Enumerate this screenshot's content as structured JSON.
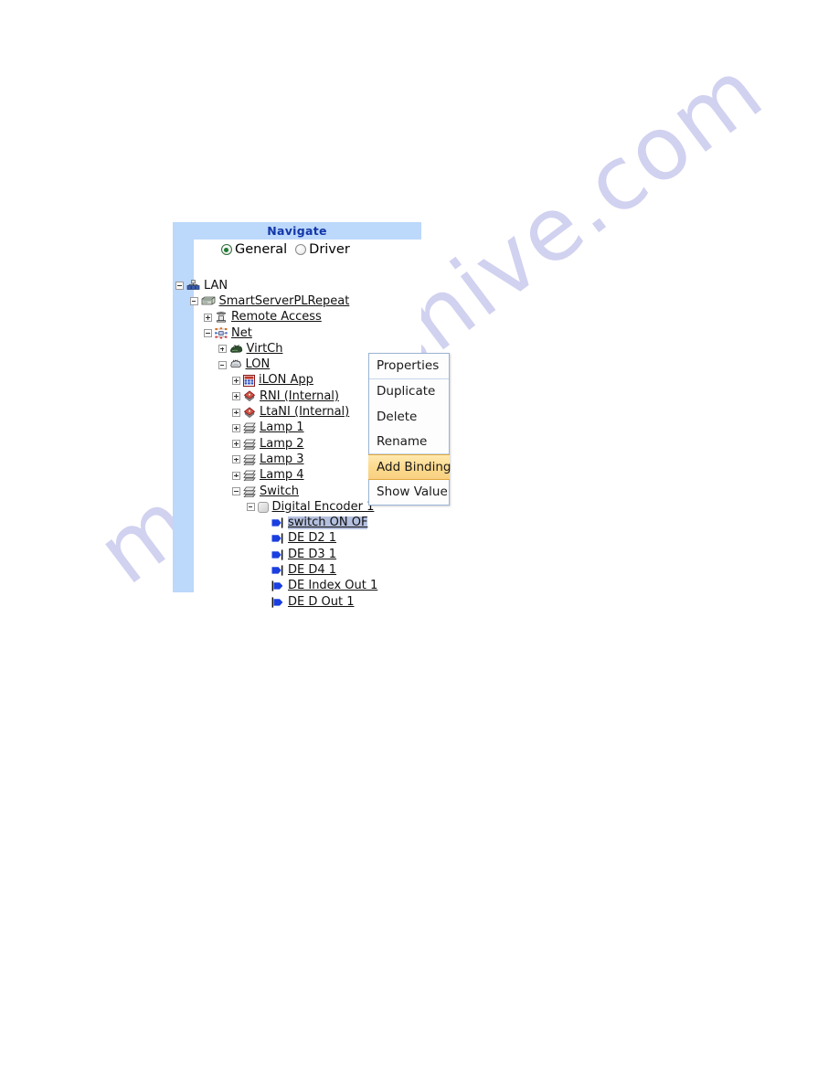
{
  "watermark": {
    "text": "manualshive.com"
  },
  "panel": {
    "title": "Navigate",
    "mode_options": [
      {
        "label": "General",
        "selected": true
      },
      {
        "label": "Driver",
        "selected": false
      }
    ]
  },
  "tree": {
    "nodes": [
      {
        "label": "LAN",
        "icon": "lan-icon",
        "depth": 0,
        "toggle": "minus",
        "underline": false
      },
      {
        "label": "SmartServerPLRepeat",
        "icon": "server-icon",
        "depth": 1,
        "toggle": "minus",
        "underline": true
      },
      {
        "label": "Remote Access",
        "icon": "remote-access-icon",
        "depth": 2,
        "toggle": "plus",
        "underline": true
      },
      {
        "label": "Net",
        "icon": "network-icon",
        "depth": 2,
        "toggle": "minus",
        "underline": true
      },
      {
        "label": "VirtCh",
        "icon": "virtual-channel-icon",
        "depth": 3,
        "toggle": "plus",
        "underline": true
      },
      {
        "label": "LON",
        "icon": "lon-channel-icon",
        "depth": 3,
        "toggle": "minus",
        "underline": true
      },
      {
        "label": "iLON App",
        "icon": "ilon-app-icon",
        "depth": 4,
        "toggle": "plus",
        "underline": true
      },
      {
        "label": "RNI (Internal)",
        "icon": "rni-device-icon",
        "depth": 4,
        "toggle": "plus",
        "underline": true
      },
      {
        "label": "LtaNI (Internal)",
        "icon": "ltani-device-icon",
        "depth": 4,
        "toggle": "plus",
        "underline": true
      },
      {
        "label": "Lamp 1",
        "icon": "lamp-device-icon",
        "depth": 4,
        "toggle": "plus",
        "underline": true
      },
      {
        "label": "Lamp 2",
        "icon": "lamp-device-icon",
        "depth": 4,
        "toggle": "plus",
        "underline": true
      },
      {
        "label": "Lamp 3",
        "icon": "lamp-device-icon",
        "depth": 4,
        "toggle": "plus",
        "underline": true
      },
      {
        "label": "Lamp 4",
        "icon": "lamp-device-icon",
        "depth": 4,
        "toggle": "plus",
        "underline": true
      },
      {
        "label": "Switch",
        "icon": "switch-device-icon",
        "depth": 4,
        "toggle": "minus",
        "underline": true
      },
      {
        "label": "Digital Encoder 1",
        "icon": "functional-block-icon",
        "depth": 5,
        "toggle": "minus",
        "underline": true
      },
      {
        "label": "switch ON  OF",
        "icon": "nv-input-icon",
        "depth": 6,
        "toggle": "none",
        "underline": true,
        "selected": true
      },
      {
        "label": "DE  D2  1",
        "icon": "nv-input-icon",
        "depth": 6,
        "toggle": "none",
        "underline": true
      },
      {
        "label": "DE  D3  1",
        "icon": "nv-input-icon",
        "depth": 6,
        "toggle": "none",
        "underline": true
      },
      {
        "label": "DE  D4  1",
        "icon": "nv-input-icon",
        "depth": 6,
        "toggle": "none",
        "underline": true
      },
      {
        "label": "DE  Index  Out  1",
        "icon": "nv-output-icon",
        "depth": 6,
        "toggle": "none",
        "underline": true
      },
      {
        "label": "DE  D  Out  1",
        "icon": "nv-output-icon",
        "depth": 6,
        "toggle": "none",
        "underline": true
      }
    ]
  },
  "context_menu": {
    "items": [
      {
        "label": "Properties",
        "highlighted": false,
        "separator_below": true
      },
      {
        "label": "Duplicate",
        "highlighted": false,
        "separator_below": false
      },
      {
        "label": "Delete",
        "highlighted": false,
        "separator_below": false
      },
      {
        "label": "Rename",
        "highlighted": false,
        "separator_below": true
      },
      {
        "label": "Add Binding",
        "highlighted": true,
        "separator_below": false
      },
      {
        "label": "Show Value",
        "highlighted": false,
        "separator_below": false
      }
    ]
  },
  "colors": {
    "panel_header_bg": "#bcd8fb",
    "panel_header_text": "#1337a8",
    "menu_highlight": "#fcd98b",
    "menu_highlight_border": "#e2a73f",
    "selection_bg": "#b4c0de",
    "nv_arrow": "#1a3fe0",
    "watermark": "#c9c9ee"
  }
}
